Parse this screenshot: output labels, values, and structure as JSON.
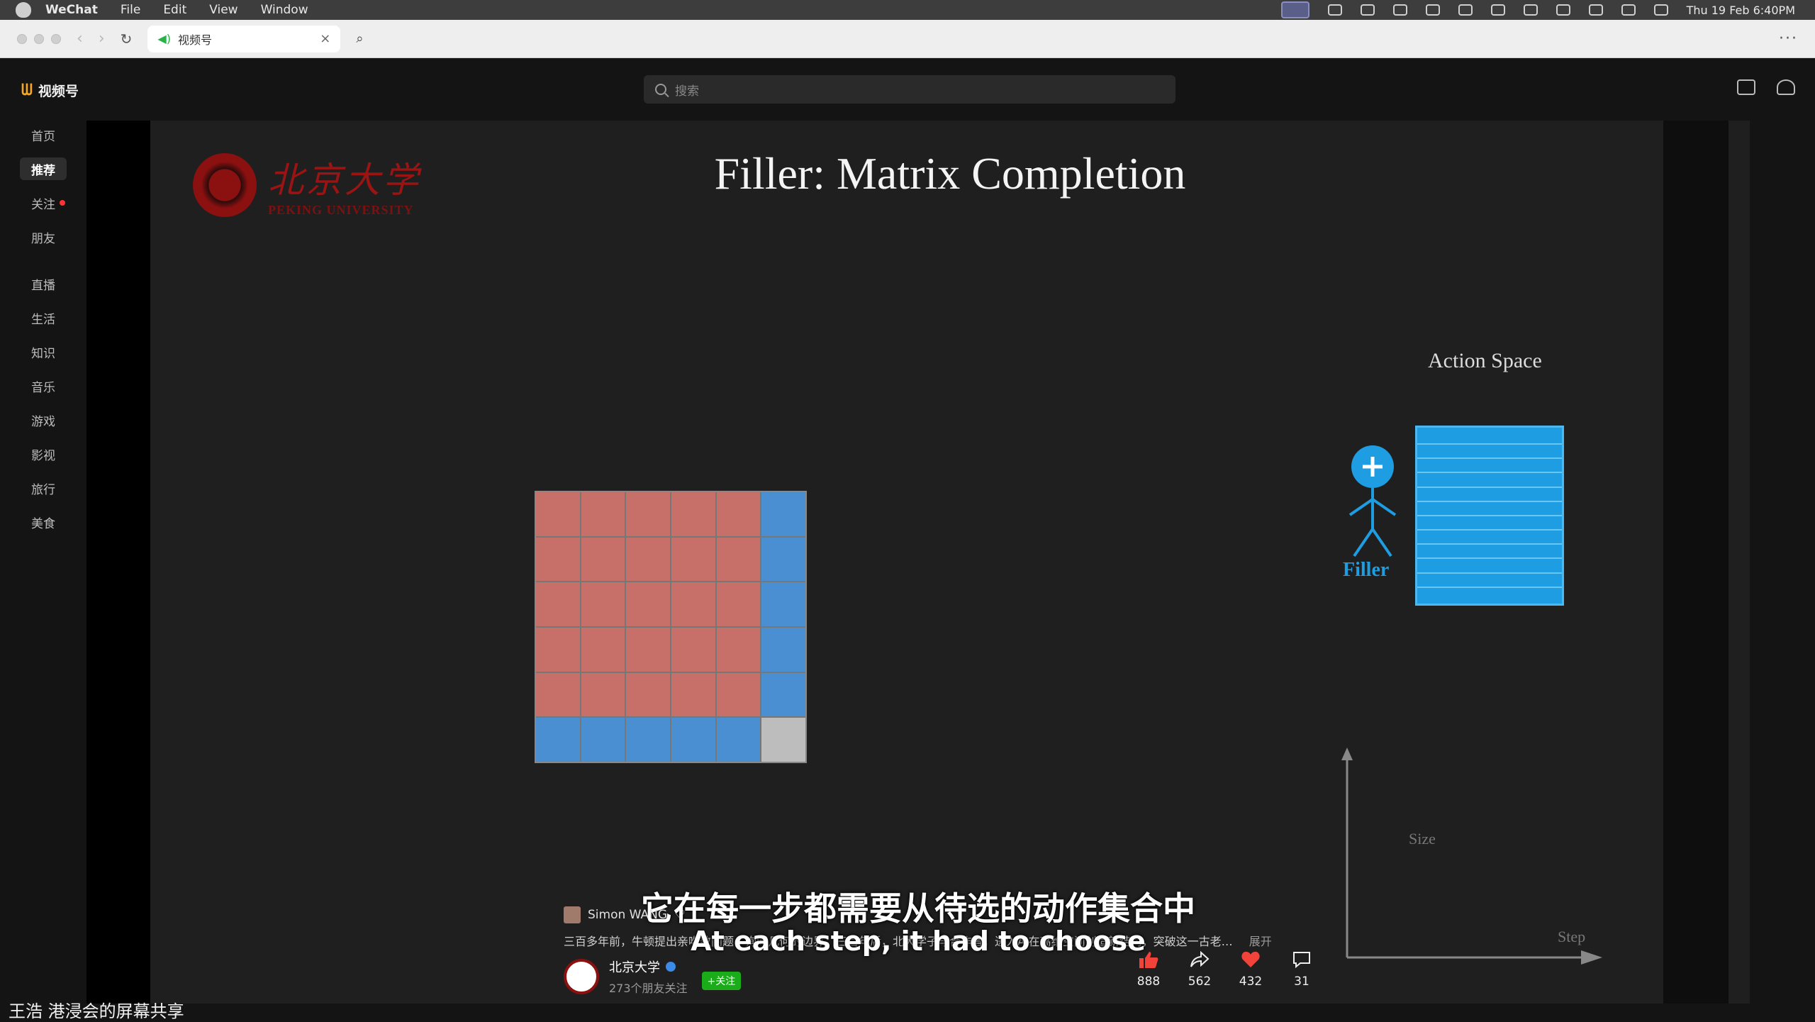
{
  "menubar": {
    "app": "WeChat",
    "items": [
      "File",
      "Edit",
      "View",
      "Window"
    ],
    "clock": "Thu 19 Feb  6:40PM"
  },
  "browser": {
    "tab_title": "视频号"
  },
  "header": {
    "brand": "视频号",
    "search_placeholder": "搜索"
  },
  "sidebar": {
    "items": [
      {
        "label": "首页"
      },
      {
        "label": "推荐"
      },
      {
        "label": "关注"
      },
      {
        "label": "朋友"
      },
      {
        "label": "直播"
      },
      {
        "label": "生活"
      },
      {
        "label": "知识"
      },
      {
        "label": "音乐"
      },
      {
        "label": "游戏"
      },
      {
        "label": "影视"
      },
      {
        "label": "旅行"
      },
      {
        "label": "美食"
      }
    ],
    "active_index": 1
  },
  "slide": {
    "university_cn": "北京大学",
    "university_en": "PEKING UNIVERSITY",
    "title": "Filler: Matrix Completion",
    "action_space": "Action Space",
    "filler": "Filler",
    "y_axis": "Size",
    "x_axis": "Step"
  },
  "video": {
    "subtitle_cn": "它在每一步都需要从待选的动作集合中",
    "subtitle_en": "At each step, it had to choose",
    "commenter": "Simon WANG",
    "description": "三百多年前，牛顿提出亲吻数问题，询问几何的边界；三百年后，北大学子与合作者，进入AI在高维空间创造新结构，突破这一古老…",
    "expand": "展开",
    "author_name": "北京大学",
    "author_fans": "273个朋友关注",
    "follow": "+关注",
    "stats": {
      "likes": "888",
      "shares": "562",
      "favorites": "432",
      "comments": "31"
    }
  },
  "screen_share_label": "王浩 港浸会的屏幕共享",
  "colors": {
    "matrix_red": "#c7706a",
    "matrix_blue": "#4a8fd2",
    "matrix_gray": "#bdbdbd",
    "filler_blue": "#1e9de2",
    "follow_green": "#1aad19",
    "pku_red": "#9a1414"
  }
}
